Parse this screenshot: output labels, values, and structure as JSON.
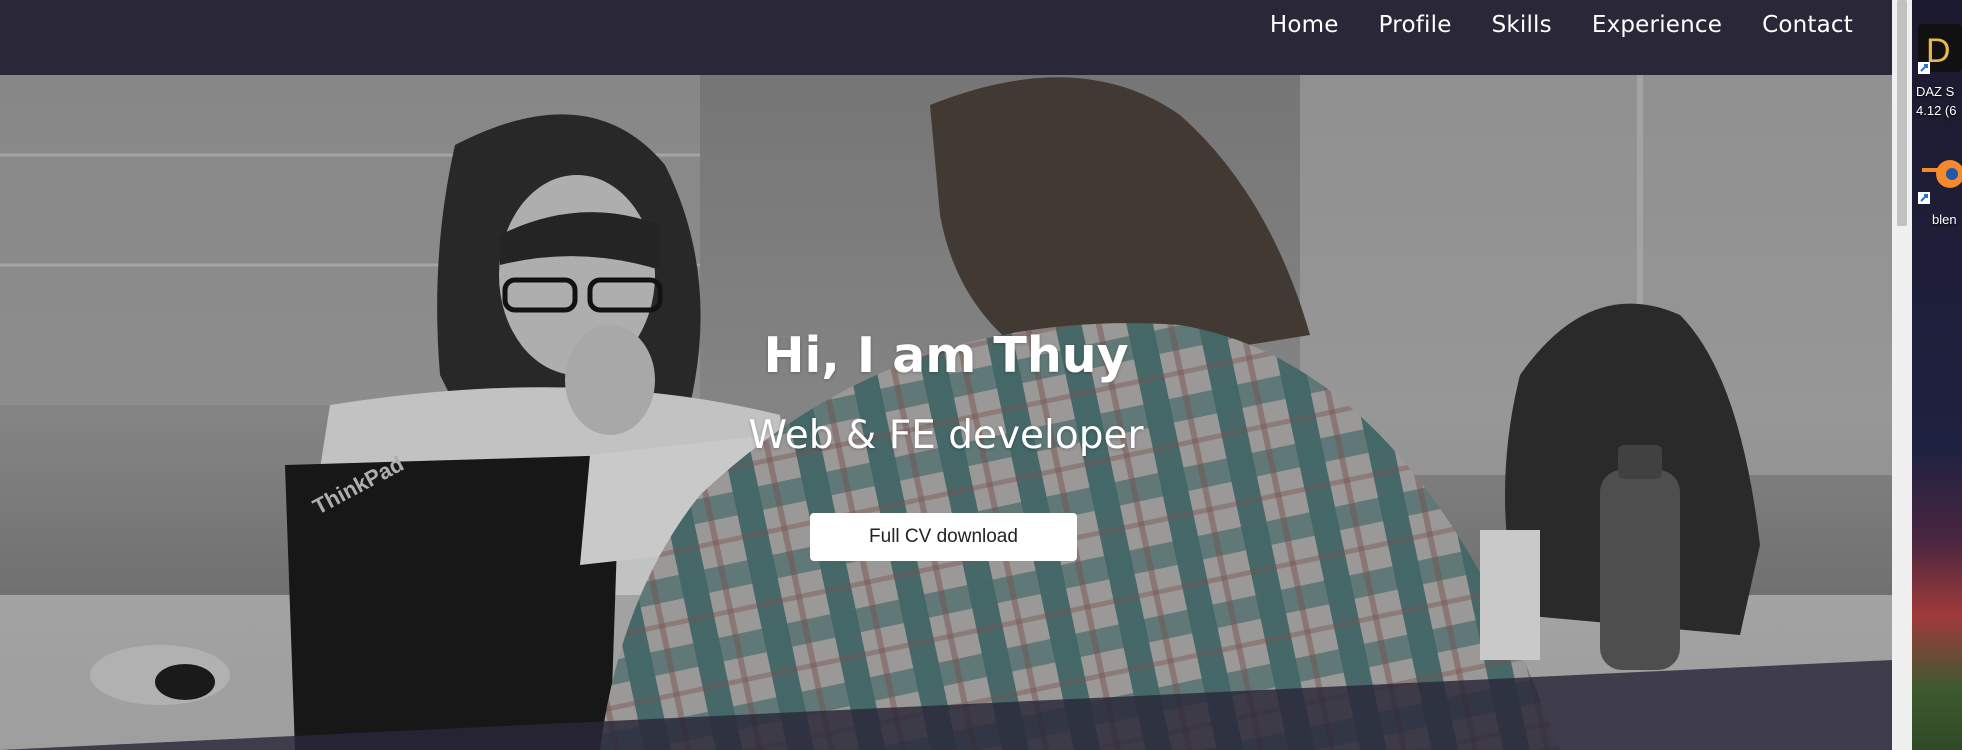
{
  "nav": {
    "items": [
      {
        "label": "Home"
      },
      {
        "label": "Profile"
      },
      {
        "label": "Skills"
      },
      {
        "label": "Experience"
      },
      {
        "label": "Contact"
      }
    ]
  },
  "hero": {
    "title": "Hi, I am Thuy",
    "subtitle": "Web & FE developer",
    "cta_label": "Full CV download",
    "laptop_brand": "ThinkPad"
  },
  "desktop": {
    "icons": [
      {
        "name": "daz-studio-icon",
        "label_line1": "DAZ S",
        "label_line2": "4.12 (6"
      },
      {
        "name": "blender-icon",
        "label_line1": "blen"
      }
    ]
  },
  "colors": {
    "navbar": "#2a2738",
    "button_bg": "#ffffff",
    "text": "#ffffff"
  }
}
